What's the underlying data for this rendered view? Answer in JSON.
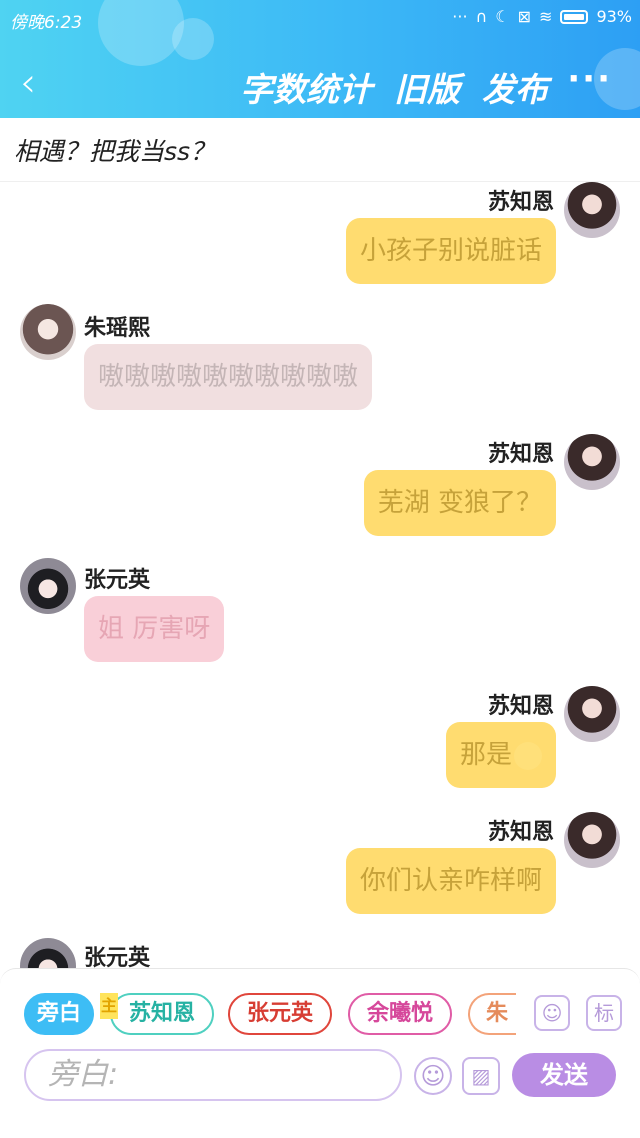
{
  "status_bar": {
    "time": "傍晚6:23",
    "indicators": "···",
    "battery": "93%"
  },
  "nav": {
    "back_icon": "back-icon",
    "word_count": "字数统计",
    "old_version": "旧版",
    "publish": "发布",
    "more": "···"
  },
  "story": {
    "title": "相遇？把我当ss？"
  },
  "messages": [
    {
      "side": "right",
      "name": "苏知恩",
      "text": "小孩子别说脏话",
      "color": "#ffdc70"
    },
    {
      "side": "left",
      "name": "朱瑶熙",
      "text": "嗷嗷嗷嗷嗷嗷嗷嗷嗷嗷",
      "color": "#f1dfe0"
    },
    {
      "side": "right",
      "name": "苏知恩",
      "text": "芜湖 变狼了？",
      "color": "#ffdc70"
    },
    {
      "side": "left",
      "name": "张元英",
      "text": "姐 厉害呀",
      "color": "#f9cfd8"
    },
    {
      "side": "right",
      "name": "苏知恩",
      "text": "那是",
      "icon": "smile-emoji",
      "color": "#ffdc70"
    },
    {
      "side": "right",
      "name": "苏知恩",
      "text": "你们认亲咋样啊",
      "color": "#ffdc70"
    },
    {
      "side": "left",
      "name": "张元英",
      "text": "",
      "color": "#f9cfd8"
    }
  ],
  "characters": {
    "narration": "旁白",
    "host_tag": "主",
    "list": [
      "苏知恩",
      "张元英",
      "余曦悦",
      "朱瑶"
    ]
  },
  "tools": {
    "person_icon": "person-card-icon",
    "tag": "标"
  },
  "composer": {
    "placeholder": "旁白:",
    "emoji_icon": "emoji-icon",
    "image_icon": "image-icon",
    "send": "发送"
  },
  "colors": {
    "header": "#3cb8f6",
    "accent": "#b98de4",
    "me_bubble": "#ffdc70"
  }
}
